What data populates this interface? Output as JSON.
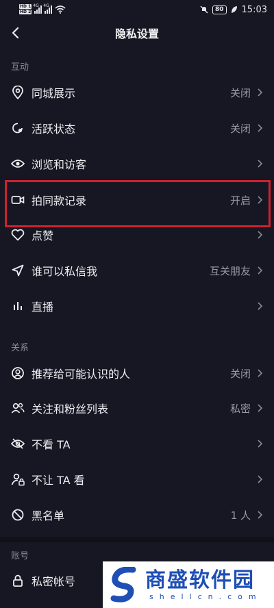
{
  "status_bar": {
    "sim1": "HD 1",
    "sim2": "HD 2",
    "net1": "4G",
    "net2": "4G",
    "battery": "80",
    "time": "15:03"
  },
  "nav": {
    "title": "隐私设置"
  },
  "sections": {
    "interaction": "互动",
    "relations": "关系",
    "account": "账号"
  },
  "rows": [
    {
      "label": "同城展示",
      "value": "关闭",
      "icon": "location-pin-icon"
    },
    {
      "label": "活跃状态",
      "value": "关闭",
      "icon": "activity-status-icon"
    },
    {
      "label": "浏览和访客",
      "value": "",
      "icon": "eye-icon"
    },
    {
      "label": "拍同款记录",
      "value": "开启",
      "icon": "video-camera-icon"
    },
    {
      "label": "点赞",
      "value": "",
      "icon": "heart-icon"
    },
    {
      "label": "谁可以私信我",
      "value": "互关朋友",
      "icon": "send-icon"
    },
    {
      "label": "直播",
      "value": "",
      "icon": "live-bars-icon"
    },
    {
      "label": "推荐给可能认识的人",
      "value": "关闭",
      "icon": "user-circle-icon"
    },
    {
      "label": "关注和粉丝列表",
      "value": "私密",
      "icon": "users-icon"
    },
    {
      "label": "不看 TA",
      "value": "",
      "icon": "eye-off-icon"
    },
    {
      "label": "不让 TA 看",
      "value": "",
      "icon": "user-lock-icon"
    },
    {
      "label": "黑名单",
      "value": "1 人",
      "icon": "block-icon"
    },
    {
      "label": "私密帐号",
      "value": "",
      "icon": "lock-icon"
    }
  ],
  "watermark": {
    "cn": "商盛软件园",
    "en": "shellcn.com"
  },
  "colors": {
    "background": "#161722",
    "highlight": "#d0202e",
    "watermark_blue": "#1f4fb5"
  }
}
